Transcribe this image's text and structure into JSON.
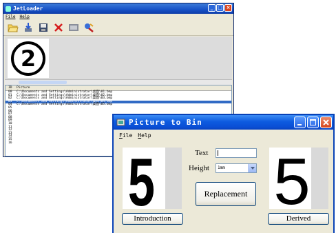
{
  "jetloader": {
    "title": "JetLoader",
    "menu": [
      "File",
      "Help"
    ],
    "toolbar_icons": [
      "open-folder-icon",
      "download-icon",
      "save-icon",
      "delete-icon",
      "image-icon",
      "convert-icon"
    ],
    "list": {
      "columns": [
        "ID",
        "Picture"
      ],
      "rows": [
        {
          "id": "00",
          "picture": "C:\\Documents and Settings\\Administrator\\桌面\\01.bmp"
        },
        {
          "id": "01",
          "picture": "C:\\Documents and Settings\\Administrator\\桌面\\02.bmp"
        },
        {
          "id": "02",
          "picture": "C:\\Documents and Settings\\Administrator\\桌面\\03.bmp"
        },
        {
          "id": "03",
          "picture": "C:\\Documents and Settings\\Administrator\\桌面\\04.bmp"
        },
        {
          "id": "04",
          "picture": "C:\\Documents and Settings\\Administrator\\桌面\\05.bmp"
        },
        {
          "id": "05",
          "picture": ""
        },
        {
          "id": "06",
          "picture": ""
        },
        {
          "id": "07",
          "picture": ""
        },
        {
          "id": "08",
          "picture": ""
        },
        {
          "id": "09",
          "picture": ""
        },
        {
          "id": "10",
          "picture": ""
        },
        {
          "id": "11",
          "picture": ""
        },
        {
          "id": "12",
          "picture": ""
        },
        {
          "id": "13",
          "picture": ""
        },
        {
          "id": "14",
          "picture": ""
        },
        {
          "id": "15",
          "picture": ""
        },
        {
          "id": "16",
          "picture": ""
        }
      ],
      "selected_index": 3
    },
    "preview_glyph": "②"
  },
  "picturetobin": {
    "title": "Picture to Bin",
    "menu": [
      {
        "label": "File",
        "accel": "F"
      },
      {
        "label": "Help",
        "accel": "H"
      }
    ],
    "text_label": "Text",
    "text_value": "",
    "height_label": "Height",
    "height_value": "1mm",
    "replace_label": "Replacement",
    "intro_label": "Introduction",
    "derived_label": "Derived",
    "left_glyph": "5",
    "right_glyph": "5"
  },
  "colors": {
    "xp_title_blue": "#0d5be0",
    "selection_blue": "#316ac5",
    "window_face": "#ece9d8",
    "close_red": "#d5451c"
  }
}
